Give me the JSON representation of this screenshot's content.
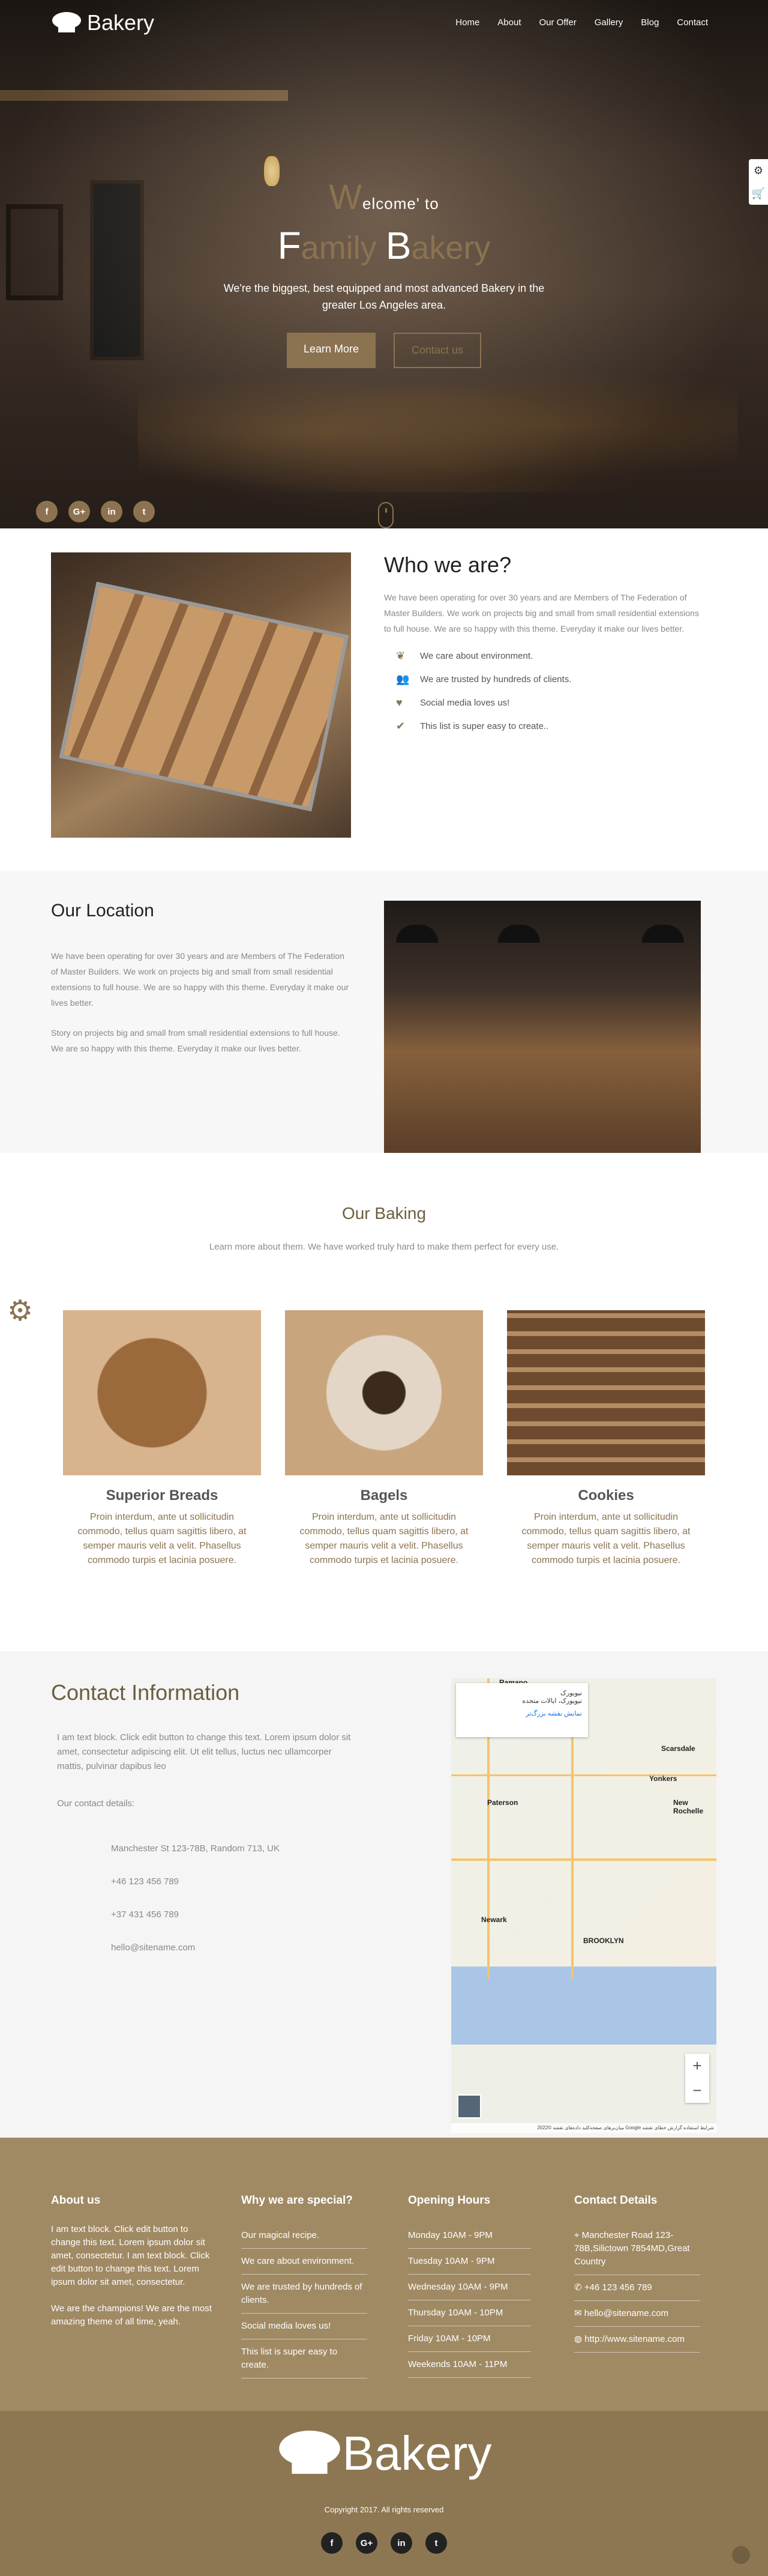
{
  "brand": {
    "name": "Bakery"
  },
  "nav": {
    "items": [
      "Home",
      "About",
      "Our Offer",
      "Gallery",
      "Blog",
      "Contact"
    ]
  },
  "hero": {
    "welcome_cap": "W",
    "welcome_rest": "elcome' to",
    "family_f": "F",
    "family_rest": "amily ",
    "family_b": "B",
    "family_end": "akery",
    "subtitle": "We're the biggest, best equipped and most advanced Bakery in the greater Los Angeles area.",
    "learn_more": "Learn More",
    "contact_us": "Contact us",
    "social": [
      "f",
      "G+",
      "in",
      "t"
    ]
  },
  "who": {
    "title": "Who we are?",
    "text": "We have been operating for over 30 years and are Members of The Federation of Master Builders. We work on projects big and small from small residential extensions to full house. We are so happy with this theme. Everyday it make our lives better.",
    "features": [
      {
        "icon": "leaf-icon",
        "glyph": "❦",
        "text": "We care about environment."
      },
      {
        "icon": "users-icon",
        "glyph": "👥",
        "text": "We are trusted by hundreds of clients."
      },
      {
        "icon": "heart-icon",
        "glyph": "♥",
        "text": "Social media loves us!"
      },
      {
        "icon": "check-icon",
        "glyph": "✔",
        "text": "This list is super easy to create.."
      }
    ]
  },
  "location": {
    "title": "Our Location",
    "p1": "We have been operating for over 30 years and are Members of The Federation of Master Builders. We work on projects big and small from small residential extensions to full house. We are so happy with this theme. Everyday it make our lives better.",
    "p2": "Story on projects big and small from small residential extensions to full house. We are so happy with this theme. Everyday it make our lives better."
  },
  "baking": {
    "title": "Our Baking",
    "subtitle": "Learn more about them. We have worked truly hard to make them perfect for every use.",
    "cards": [
      {
        "title": "Superior Breads",
        "text": "Proin interdum, ante ut sollicitudin commodo, tellus quam sagittis libero, at semper mauris velit a velit. Phasellus commodo turpis et lacinia posuere."
      },
      {
        "title": "Bagels",
        "text": "Proin interdum, ante ut sollicitudin commodo, tellus quam sagittis libero, at semper mauris velit a velit. Phasellus commodo turpis et lacinia posuere."
      },
      {
        "title": "Cookies",
        "text": "Proin interdum, ante ut sollicitudin commodo, tellus quam sagittis libero, at semper mauris velit a velit. Phasellus commodo turpis et lacinia posuere."
      }
    ]
  },
  "contact": {
    "title": "Contact Information",
    "intro": "I am text block. Click edit button to change this text. Lorem ipsum dolor sit amet, consectetur adipiscing elit. Ut elit tellus, luctus nec ullamcorper mattis, pulvinar dapibus leo",
    "details_label": "Our contact details:",
    "address": "Manchester St 123-78B, Random 713, UK",
    "phone1": "+46 123 456 789",
    "phone2": "+37 431 456 789",
    "email": "hello@sitename.com"
  },
  "map": {
    "card_title": "نیویورک",
    "card_sub": "نیویورک، ایالات متحده",
    "card_link": "نمایش نقشه بزرگ‌تر",
    "labels": [
      "Ramapo",
      "Yonkers",
      "Newark",
      "BROOKLYN",
      "New Rochelle",
      "Paterson",
      "Scarsdale"
    ],
    "credit": "میان‌برهای صفحه‌کلید  داده‌های نقشه ©2022 Google  شرایط استفاده  گزارش خطای نقشه",
    "zoom_in": "+",
    "zoom_out": "−"
  },
  "footer": {
    "about_title": "About us",
    "about_text": "I am text block. Click edit button to change this text. Lorem ipsum dolor sit amet, consectetur. I am text block. Click edit button to change this text. Lorem ipsum dolor sit amet, consectetur.",
    "about_text2": "We are the champions! We are the most amazing theme of all time, yeah.",
    "why_title": "Why we are special?",
    "why": [
      "Our magical recipe.",
      "We care about environment.",
      "We are trusted by hundreds of clients.",
      "Social media loves us!",
      "This list is super easy to create."
    ],
    "hours_title": "Opening Hours",
    "hours": [
      "Monday 10AM - 9PM",
      "Tuesday 10AM - 9PM",
      "Wednesday 10AM - 9PM",
      "Thursday 10AM - 10PM",
      "Friday 10AM - 10PM",
      "Weekends 10AM - 11PM"
    ],
    "contact_title": "Contact Details",
    "contact_address": "Manchester Road 123-78B,Silictown 7854MD,Great Country",
    "contact_phone": "+46 123 456 789",
    "contact_email": "hello@sitename.com",
    "contact_web": "http://www.sitename.com",
    "copyright": "Copyright 2017. All rights reserved",
    "social": [
      "f",
      "G+",
      "in",
      "t"
    ]
  },
  "colors": {
    "accent": "#8b7351",
    "footer_top": "#a08a64",
    "footer_bottom": "#8d7752"
  }
}
